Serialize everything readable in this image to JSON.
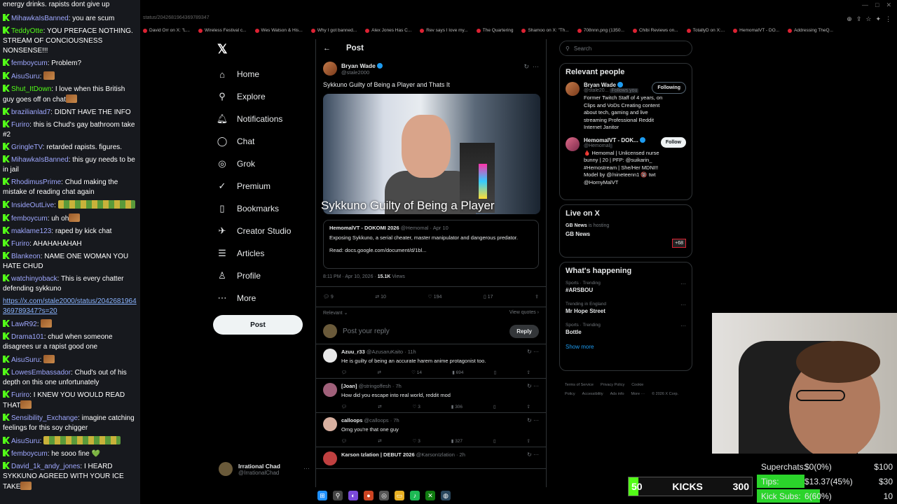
{
  "chat": {
    "first_line": "energy drinks. rapists dont give up",
    "messages": [
      {
        "user": "MihawkaIsBanned",
        "color": "#9fa8ff",
        "text": "you are scum",
        "emote": ""
      },
      {
        "user": "TeddyOtte",
        "color": "#53fc18",
        "text": "YOU PREFACE NOTHING. STREAM OF CONCIOUSNESS NONSENSE!!!",
        "emote": ""
      },
      {
        "user": "femboycum",
        "color": "#9fa8ff",
        "text": "Problem?",
        "emote": ""
      },
      {
        "user": "AisuSuru",
        "color": "#9fa8ff",
        "text": "",
        "emote": "small"
      },
      {
        "user": "Shut_ItDown",
        "color": "#53fc18",
        "text": "I love when this British guy goes off on chat",
        "emote": "small"
      },
      {
        "user": "brazilianlad7",
        "color": "#9fa8ff",
        "text": "DIDNT HAVE THE INFO",
        "emote": ""
      },
      {
        "user": "Furiro",
        "color": "#9fa8ff",
        "text": "this is Chud's gay bathroom take #2",
        "emote": ""
      },
      {
        "user": "GringleTV",
        "color": "#9fa8ff",
        "text": "retarded rapists. figures.",
        "emote": ""
      },
      {
        "user": "MihawkaIsBanned",
        "color": "#9fa8ff",
        "text": "this guy needs to be in jail",
        "emote": ""
      },
      {
        "user": "RhodimusPrime",
        "color": "#9fa8ff",
        "text": "Chud making the mistake of reading chat again",
        "emote": ""
      },
      {
        "user": "InsideOutLive",
        "color": "#9fa8ff",
        "text": "",
        "emote": "wide"
      },
      {
        "user": "femboycum",
        "color": "#9fa8ff",
        "text": "uh oh",
        "emote": "small"
      },
      {
        "user": "maklame123",
        "color": "#9fa8ff",
        "text": "raped by kick chat",
        "emote": ""
      },
      {
        "user": "Furiro",
        "color": "#9fa8ff",
        "text": "AHAHAHAHAH",
        "emote": ""
      },
      {
        "user": "Blankeon",
        "color": "#9fa8ff",
        "text": "NAME ONE WOMAN YOU HATE CHUD",
        "emote": ""
      },
      {
        "user": "watchinyoback",
        "color": "#9fa8ff",
        "text": "This is every chatter defending sykkuno",
        "emote": ""
      },
      {
        "user": "",
        "color": "#8ab4ff",
        "text": "https://x.com/stale2000/status/2042681964369789347?s=20",
        "emote": "",
        "link": true
      },
      {
        "user": "LawR92",
        "color": "#9fa8ff",
        "text": "",
        "emote": "small"
      },
      {
        "user": "Drama101",
        "color": "#9fa8ff",
        "text": "chud when someone disagrees ur a rapist good one",
        "emote": ""
      },
      {
        "user": "AisuSuru",
        "color": "#9fa8ff",
        "text": "",
        "emote": "small"
      },
      {
        "user": "LowesEmbassador",
        "color": "#9fa8ff",
        "text": "Chud's out of his depth on this one unfortunately",
        "emote": ""
      },
      {
        "user": "Furiro",
        "color": "#9fa8ff",
        "text": "I KNEW YOU WOULD READ THAT",
        "emote": "small"
      },
      {
        "user": "Sensibility_Exchange",
        "color": "#9fa8ff",
        "text": "imagine catching feelings for this soy chigger",
        "emote": ""
      },
      {
        "user": "AisuSuru",
        "color": "#9fa8ff",
        "text": "",
        "emote": "wide"
      },
      {
        "user": "femboycum",
        "color": "#9fa8ff",
        "text": "he sooo fine 💚",
        "emote": ""
      },
      {
        "user": "David_1k_andy_jones",
        "color": "#9fa8ff",
        "text": "I HEARD SYKKUNO AGREED WITH YOUR ICE TAKE",
        "emote": "small"
      }
    ]
  },
  "browser": {
    "url_fragment": "status/2042681964369789347",
    "bookmarks": [
      "David Orr on X: \"L...",
      "Wireless Festival c...",
      "Wes Watson & His...",
      "Why I got banned...",
      "Alex Jones Has C...",
      "Rev says I love my...",
      "The Quartering",
      "Shamoo on X: \"Th...",
      "708nnn.png (1350...",
      "Chibi Reviews on...",
      "TotallyD on X:...",
      "HemomalVT - DO...",
      "Addressing TheQ..."
    ]
  },
  "nav": {
    "logo": "𝕏",
    "items": [
      {
        "label": "Home",
        "icon": "⌂",
        "name": "home"
      },
      {
        "label": "Explore",
        "icon": "⚲",
        "name": "explore"
      },
      {
        "label": "Notifications",
        "icon": "🔔︎",
        "name": "notifications"
      },
      {
        "label": "Chat",
        "icon": "◯",
        "name": "chat"
      },
      {
        "label": "Grok",
        "icon": "◎",
        "name": "grok"
      },
      {
        "label": "Premium",
        "icon": "✓",
        "name": "premium"
      },
      {
        "label": "Bookmarks",
        "icon": "▯",
        "name": "bookmarks"
      },
      {
        "label": "Creator Studio",
        "icon": "✈",
        "name": "creator-studio"
      },
      {
        "label": "Articles",
        "icon": "☰",
        "name": "articles"
      },
      {
        "label": "Profile",
        "icon": "♙",
        "name": "profile"
      },
      {
        "label": "More",
        "icon": "⋯",
        "name": "more"
      }
    ],
    "post_label": "Post",
    "account": {
      "name": "Irrational Chad",
      "handle": "@IrrationalChad"
    }
  },
  "post": {
    "header_title": "Post",
    "author_name": "Bryan Wade",
    "author_handle": "@stale2000",
    "text": "Sykkuno Guilty of Being a Player and Thats It",
    "video_caption": "Sykkuno Guilty of Being a Player",
    "quote": {
      "name": "HemomalVT - DOKOMI 2026",
      "handle": "@Hemomal",
      "date": "Apr 10",
      "text": "Exposing Sykkuno, a serial cheater, master manipulator and dangerous predator.",
      "read": "Read: docs.google.com/document/d/1bl..."
    },
    "time": "8:11 PM · Apr 10, 2026",
    "views": "15.1K",
    "views_label": "Views",
    "stats": {
      "replies": "9",
      "reposts": "10",
      "likes": "194",
      "bookmarks": "17"
    },
    "filter_label": "Relevant",
    "view_quotes": "View quotes",
    "reply_placeholder": "Post your reply",
    "reply_button": "Reply"
  },
  "replies": [
    {
      "name": "Azuu_r33",
      "handle": "@AzusaruKaito",
      "time": "11h",
      "text": "He is guilty of being an accurate harem anime protagonist too.",
      "likes": "14",
      "views": "694",
      "avatar": "#e8e8e8"
    },
    {
      "name": "[Joan]",
      "handle": "@stringoffesh",
      "time": "7h",
      "text": "How did you escape into real world, reddit mod",
      "likes": "3",
      "views": "306",
      "avatar": "#a0607a"
    },
    {
      "name": "calloops",
      "handle": "@calloops",
      "time": "7h",
      "text": "Omg you're that one guy",
      "likes": "3",
      "views": "327",
      "avatar": "#d8b0a0"
    },
    {
      "name": "Karson Izlation | DEBUT 2026",
      "handle": "@KarsonIzlation",
      "time": "2h",
      "text": "",
      "likes": "",
      "views": "",
      "avatar": "#c04040"
    }
  ],
  "right": {
    "search_placeholder": "Search",
    "relevant_title": "Relevant people",
    "people": [
      {
        "name": "Bryan Wade",
        "handle": "@stale20...",
        "badge": "Follows you",
        "button": "Following",
        "bio": "Former Twitch Staff of 4 years, on Clips and VoDs Creating content about tech, gaming and live streaming Professional Reddit Internet Janitor"
      },
      {
        "name": "HemomalVT - DOK...",
        "handle": "@Hemomal",
        "badge": "",
        "button": "Follow",
        "bio": "🩸 Hemomal | Unlicensed nurse bunny | 20 | PFP: @suikarin_ #Hemostream | She/Her MDNI!! Model by @/nineteenn1 🔞 twt @HornyMalVT"
      }
    ],
    "live_title": "Live on X",
    "live": {
      "host": "GB News",
      "hosting_label": "is hosting",
      "name": "GB News",
      "count": "+68"
    },
    "happening_title": "What's happening",
    "trends": [
      {
        "meta": "Sports · Trending",
        "name": "#ARSBOU"
      },
      {
        "meta": "Trending in England",
        "name": "Mr Hope Street"
      },
      {
        "meta": "Sports · Trending",
        "name": "Bottle"
      }
    ],
    "show_more": "Show more",
    "footer": [
      "Terms of Service",
      "Privacy Policy",
      "Cookie Policy",
      "Accessibility",
      "Ads info",
      "More ···",
      "© 2026 X Corp."
    ]
  },
  "overlay": {
    "goals": [
      {
        "label": "Superchats:",
        "value": "$0(0%)",
        "target": "$100",
        "fraction": 0.0
      },
      {
        "label": "Tips:",
        "value": "$13.37(45%)",
        "target": "$30",
        "fraction": 0.45
      },
      {
        "label": "Kick Subs:",
        "value": "6(60%)",
        "target": "10",
        "fraction": 0.6
      }
    ],
    "kicks": {
      "current": "50",
      "label": "KICKS",
      "target": "300",
      "fraction": 0.08
    }
  },
  "colors": {
    "accent": "#1d9bf0",
    "kick_green": "#53fc18",
    "goal_green": "#2bd42b",
    "bg": "#000000"
  }
}
